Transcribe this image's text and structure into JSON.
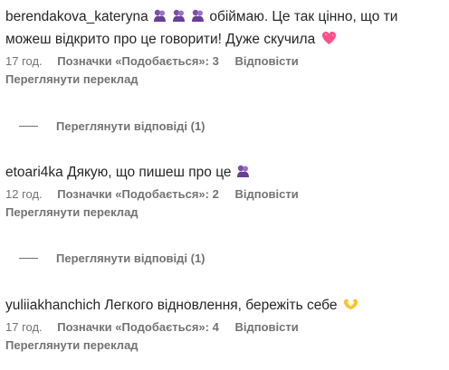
{
  "comments": [
    {
      "username": "berendakova_kateryna",
      "text_part1": " обіймаю. Це так цінно, що ти можеш відкрито про це говорити! Дуже скучила",
      "time": "17 год.",
      "likes": "Позначки «Подобається»: 3",
      "reply": "Відповісти",
      "translate": "Переглянути переклад",
      "view_replies": "Переглянути відповіді (1)",
      "emojis": [
        "hug-emoji",
        "hug-emoji",
        "hug-emoji",
        "sparkling-heart-emoji"
      ]
    },
    {
      "username": "etoari4ka",
      "text_part1": " Дякую, що пишеш про це",
      "time": "12 год.",
      "likes": "Позначки «Подобається»: 2",
      "reply": "Відповісти",
      "translate": "Переглянути переклад",
      "view_replies": "Переглянути відповіді (1)",
      "emojis": [
        "hug-emoji"
      ]
    },
    {
      "username": "yuliiakhanchich",
      "text_part1": " Легкого відновлення, бережіть себе",
      "time": "17 год.",
      "likes": "Позначки «Подобається»: 4",
      "reply": "Відповісти",
      "translate": "Переглянути переклад",
      "emojis": [
        "heart-hands-emoji"
      ]
    }
  ],
  "colors": {
    "text": "#262626",
    "secondary": "#737373",
    "hug_purple": "#7b4fa8",
    "heart_pink": "#ff4f8b",
    "hands_yellow": "#f7c531"
  }
}
